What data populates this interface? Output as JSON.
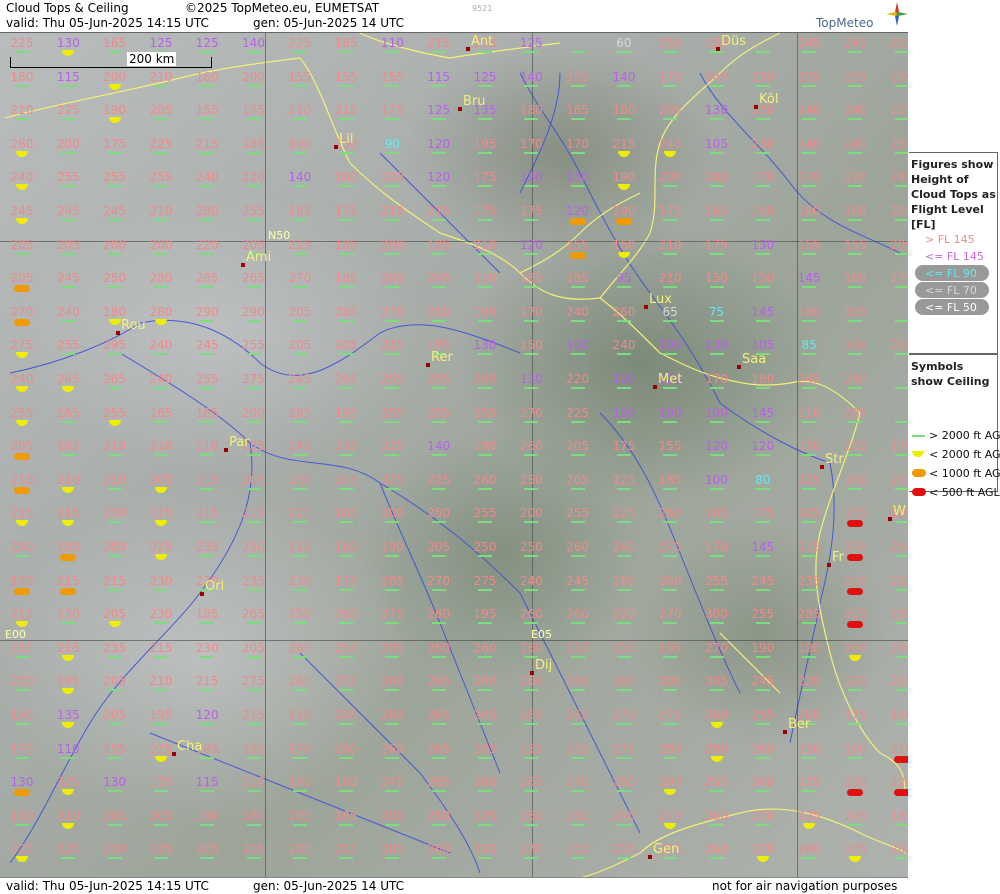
{
  "header": {
    "title": "Cloud Tops & Ceiling",
    "copyright": "©2025 TopMeteo.eu, EUMETSAT",
    "valid": "valid:  Thu  05-Jun-2025  14:15 UTC",
    "generated": "gen: 05-Jun-2025 14 UTC",
    "image_id": "9521",
    "brand": "TopMeteo"
  },
  "footer": {
    "valid": "valid:  Thu  05-Jun-2025  14:15 UTC",
    "generated": "gen: 05-Jun-2025 14 UTC",
    "disclaimer": "not for air navigation purposes"
  },
  "scale": {
    "label": "200 km"
  },
  "coords": {
    "n50": "N50",
    "e00": "E00",
    "e05": "E05"
  },
  "cities": [
    {
      "name": "Ant"
    },
    {
      "name": "Düs"
    },
    {
      "name": "Bru"
    },
    {
      "name": "Köl"
    },
    {
      "name": "Lil"
    },
    {
      "name": "Ami"
    },
    {
      "name": "Lux"
    },
    {
      "name": "Rou"
    },
    {
      "name": "Rer"
    },
    {
      "name": "Saa"
    },
    {
      "name": "Met"
    },
    {
      "name": "Par"
    },
    {
      "name": "Str"
    },
    {
      "name": "Orl"
    },
    {
      "name": "Fr"
    },
    {
      "name": "Dij"
    },
    {
      "name": "Ber"
    },
    {
      "name": "Cha"
    },
    {
      "name": "Gen"
    },
    {
      "name": "W"
    }
  ],
  "legend": {
    "figures_title": "Figures show Height of Cloud Tops as Flight Level [FL]",
    "levels": [
      {
        "label": "> FL 145",
        "color": "#f08a8a"
      },
      {
        "label": "<= FL 145",
        "color": "#cc66dd"
      },
      {
        "label": "<= FL 90",
        "color": "#66e8ee"
      },
      {
        "label": "<= FL 70",
        "color": "#d8d8d8"
      },
      {
        "label": "<= FL 50",
        "color": "#ffffff"
      }
    ],
    "symbols_title": "Symbols show Ceiling",
    "ceilings": [
      {
        "label": "> 2000 ft AGL",
        "color": "#7ddc7d"
      },
      {
        "label": "< 2000 ft AGL",
        "color": "#f0ee00"
      },
      {
        "label": "< 1000 ft AGL",
        "color": "#f09a00"
      },
      {
        "label": "< 500 ft AGL",
        "color": "#e01010"
      }
    ]
  },
  "grid_values": [
    [
      225,
      130,
      165,
      125,
      125,
      140,
      225,
      185,
      110,
      215,
      215,
      125,
      null,
      60,
      250,
      150,
      null,
      245,
      245,
      255
    ],
    [
      180,
      115,
      200,
      210,
      160,
      200,
      155,
      155,
      155,
      115,
      125,
      140,
      155,
      140,
      170,
      245,
      230,
      255,
      255,
      250
    ],
    [
      210,
      225,
      190,
      205,
      155,
      175,
      210,
      215,
      175,
      125,
      135,
      180,
      165,
      180,
      295,
      130,
      230,
      240,
      240,
      255
    ],
    [
      260,
      200,
      175,
      225,
      215,
      185,
      190,
      230,
      90,
      120,
      195,
      170,
      170,
      215,
      245,
      105,
      230,
      240,
      240,
      255
    ],
    [
      240,
      255,
      255,
      255,
      240,
      220,
      140,
      180,
      220,
      120,
      175,
      120,
      130,
      190,
      200,
      200,
      170,
      210,
      220,
      245
    ],
    [
      245,
      245,
      245,
      210,
      280,
      255,
      185,
      175,
      210,
      215,
      175,
      175,
      120,
      290,
      175,
      165,
      160,
      160,
      180,
      205
    ],
    [
      205,
      205,
      200,
      200,
      220,
      205,
      215,
      185,
      200,
      195,
      210,
      120,
      155,
      160,
      210,
      175,
      130,
      155,
      155,
      200
    ],
    [
      205,
      245,
      250,
      280,
      285,
      265,
      270,
      185,
      200,
      245,
      210,
      185,
      185,
      95,
      210,
      150,
      150,
      145,
      180,
      275
    ],
    [
      270,
      240,
      180,
      280,
      290,
      290,
      205,
      285,
      270,
      250,
      190,
      170,
      240,
      260,
      65,
      75,
      145,
      160,
      195,
      null
    ],
    [
      275,
      255,
      295,
      240,
      245,
      255,
      205,
      305,
      215,
      195,
      130,
      150,
      100,
      240,
      100,
      130,
      105,
      85,
      190,
      205
    ],
    [
      240,
      245,
      265,
      240,
      255,
      275,
      245,
      265,
      255,
      255,
      260,
      130,
      220,
      100,
      125,
      170,
      180,
      245,
      240,
      null
    ],
    [
      255,
      265,
      255,
      165,
      165,
      200,
      265,
      195,
      255,
      255,
      255,
      270,
      225,
      100,
      100,
      100,
      145,
      210,
      280,
      null
    ],
    [
      205,
      165,
      210,
      210,
      210,
      255,
      245,
      235,
      225,
      140,
      190,
      260,
      205,
      175,
      155,
      120,
      120,
      170,
      235,
      170
    ],
    [
      210,
      210,
      210,
      205,
      215,
      205,
      230,
      245,
      225,
      225,
      260,
      250,
      205,
      225,
      185,
      100,
      80,
      225,
      180,
      205
    ],
    [
      215,
      215,
      230,
      215,
      215,
      215,
      225,
      185,
      200,
      250,
      255,
      200,
      255,
      225,
      260,
      165,
      175,
      205,
      175,
      190
    ],
    [
      200,
      200,
      200,
      225,
      235,
      260,
      215,
      160,
      190,
      205,
      250,
      250,
      260,
      260,
      270,
      170,
      145,
      215,
      205,
      250
    ],
    [
      170,
      215,
      215,
      230,
      230,
      235,
      230,
      175,
      205,
      270,
      275,
      240,
      245,
      260,
      260,
      255,
      245,
      235,
      210,
      225
    ],
    [
      215,
      230,
      205,
      230,
      185,
      265,
      250,
      260,
      275,
      260,
      195,
      260,
      260,
      220,
      270,
      300,
      255,
      285,
      355,
      285
    ],
    [
      215,
      215,
      235,
      215,
      230,
      205,
      265,
      255,
      255,
      260,
      260,
      260,
      255,
      255,
      195,
      270,
      190,
      190,
      200,
      230
    ],
    [
      230,
      195,
      205,
      210,
      215,
      275,
      265,
      255,
      260,
      265,
      260,
      260,
      260,
      265,
      305,
      305,
      245,
      220,
      220,
      265
    ],
    [
      195,
      135,
      205,
      195,
      120,
      215,
      210,
      205,
      260,
      265,
      265,
      265,
      265,
      275,
      275,
      260,
      255,
      200,
      175,
      160
    ],
    [
      175,
      110,
      155,
      225,
      185,
      185,
      170,
      260,
      260,
      265,
      285,
      255,
      255,
      275,
      280,
      280,
      260,
      220,
      190,
      210
    ],
    [
      130,
      225,
      130,
      175,
      115,
      210,
      190,
      180,
      245,
      265,
      260,
      265,
      270,
      280,
      290,
      255,
      260,
      225,
      230,
      220
    ],
    [
      180,
      210,
      205,
      205,
      190,
      180,
      205,
      185,
      200,
      250,
      225,
      260,
      260,
      295,
      270,
      260,
      270,
      225,
      195,
      185
    ],
    [
      225,
      225,
      230,
      225,
      205,
      205,
      205,
      215,
      205,
      260,
      255,
      270,
      255,
      205,
      255,
      260,
      320,
      260,
      205,
      200
    ]
  ],
  "ceiling_markers": [
    [
      0,
      1,
      "yellow"
    ],
    [
      1,
      2,
      "yellow"
    ],
    [
      2,
      2,
      "yellow"
    ],
    [
      4,
      0,
      "yellow"
    ],
    [
      5,
      0,
      "yellow"
    ],
    [
      3,
      0,
      "yellow"
    ],
    [
      3,
      13,
      "yellow"
    ],
    [
      3,
      14,
      "yellow"
    ],
    [
      4,
      13,
      "yellow"
    ],
    [
      5,
      13,
      "orange"
    ],
    [
      5,
      12,
      "orange"
    ],
    [
      6,
      12,
      "orange"
    ],
    [
      7,
      0,
      "orange"
    ],
    [
      8,
      0,
      "orange"
    ],
    [
      8,
      2,
      "yellow"
    ],
    [
      8,
      3,
      "yellow"
    ],
    [
      9,
      0,
      "yellow"
    ],
    [
      6,
      13,
      "yellow"
    ],
    [
      10,
      0,
      "yellow"
    ],
    [
      10,
      1,
      "yellow"
    ],
    [
      11,
      0,
      "yellow"
    ],
    [
      11,
      2,
      "yellow"
    ],
    [
      12,
      0,
      "orange"
    ],
    [
      13,
      0,
      "orange"
    ],
    [
      13,
      1,
      "yellow"
    ],
    [
      13,
      3,
      "yellow"
    ],
    [
      14,
      0,
      "yellow"
    ],
    [
      14,
      1,
      "yellow"
    ],
    [
      14,
      3,
      "yellow"
    ],
    [
      15,
      1,
      "orange"
    ],
    [
      15,
      3,
      "yellow"
    ],
    [
      16,
      0,
      "orange"
    ],
    [
      16,
      1,
      "orange"
    ],
    [
      17,
      0,
      "yellow"
    ],
    [
      17,
      2,
      "yellow"
    ],
    [
      18,
      1,
      "yellow"
    ],
    [
      16,
      18,
      "red"
    ],
    [
      17,
      18,
      "red"
    ],
    [
      15,
      18,
      "red"
    ],
    [
      19,
      1,
      "yellow"
    ],
    [
      20,
      1,
      "yellow"
    ],
    [
      21,
      3,
      "yellow"
    ],
    [
      22,
      0,
      "orange"
    ],
    [
      22,
      1,
      "yellow"
    ],
    [
      22,
      14,
      "yellow"
    ],
    [
      22,
      18,
      "red"
    ],
    [
      22,
      19,
      "red"
    ],
    [
      21,
      19,
      "red"
    ],
    [
      23,
      1,
      "yellow"
    ],
    [
      23,
      17,
      "yellow"
    ],
    [
      24,
      0,
      "yellow"
    ],
    [
      24,
      16,
      "yellow"
    ],
    [
      24,
      18,
      "yellow"
    ],
    [
      14,
      18,
      "red"
    ],
    [
      18,
      18,
      "yellow"
    ],
    [
      20,
      15,
      "yellow"
    ],
    [
      21,
      15,
      "yellow"
    ],
    [
      23,
      14,
      "yellow"
    ]
  ]
}
